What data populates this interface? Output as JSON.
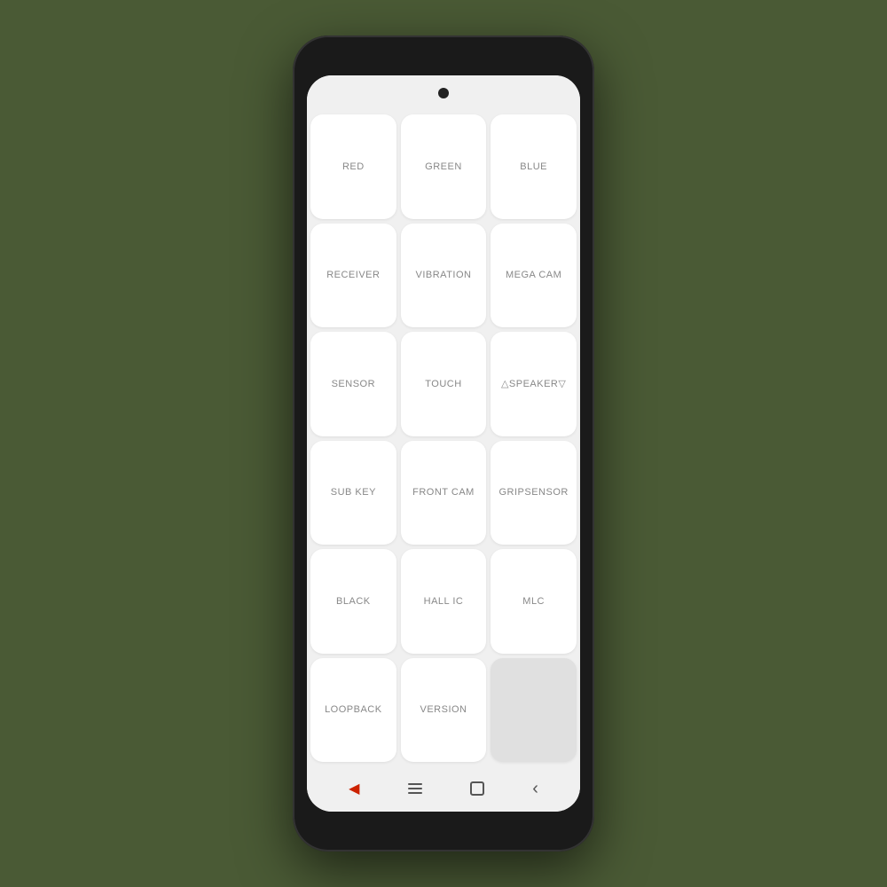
{
  "phone": {
    "background_color": "#4a5a35"
  },
  "grid": {
    "cells": [
      {
        "id": "red",
        "label": "RED",
        "row": 1,
        "col": 1,
        "empty": false
      },
      {
        "id": "green",
        "label": "GREEN",
        "row": 1,
        "col": 2,
        "empty": false
      },
      {
        "id": "blue",
        "label": "BLUE",
        "row": 1,
        "col": 3,
        "empty": false
      },
      {
        "id": "receiver",
        "label": "RECEIVER",
        "row": 2,
        "col": 1,
        "empty": false
      },
      {
        "id": "vibration",
        "label": "VIBRATION",
        "row": 2,
        "col": 2,
        "empty": false
      },
      {
        "id": "mega-cam",
        "label": "MEGA CAM",
        "row": 2,
        "col": 3,
        "empty": false
      },
      {
        "id": "sensor",
        "label": "SENSOR",
        "row": 3,
        "col": 1,
        "empty": false
      },
      {
        "id": "touch",
        "label": "TOUCH",
        "row": 3,
        "col": 2,
        "empty": false
      },
      {
        "id": "speaker",
        "label": "△SPEAKER▽",
        "row": 3,
        "col": 3,
        "empty": false
      },
      {
        "id": "sub-key",
        "label": "SUB KEY",
        "row": 4,
        "col": 1,
        "empty": false
      },
      {
        "id": "front-cam",
        "label": "FRONT CAM",
        "row": 4,
        "col": 2,
        "empty": false
      },
      {
        "id": "gripsensor",
        "label": "GRIPSENSOR",
        "row": 4,
        "col": 3,
        "empty": false
      },
      {
        "id": "black",
        "label": "BLACK",
        "row": 5,
        "col": 1,
        "empty": false
      },
      {
        "id": "hall-ic",
        "label": "HALL IC",
        "row": 5,
        "col": 2,
        "empty": false
      },
      {
        "id": "mlc",
        "label": "MLC",
        "row": 5,
        "col": 3,
        "empty": false
      },
      {
        "id": "loopback",
        "label": "LOOPBACK",
        "row": 6,
        "col": 1,
        "empty": false
      },
      {
        "id": "version",
        "label": "VERSION",
        "row": 6,
        "col": 2,
        "empty": false
      },
      {
        "id": "empty-1",
        "label": "",
        "row": 6,
        "col": 3,
        "empty": true
      }
    ]
  },
  "navbar": {
    "back_arrow": "◀",
    "lines_label": "menu",
    "square_label": "home",
    "chevron_label": "back"
  }
}
